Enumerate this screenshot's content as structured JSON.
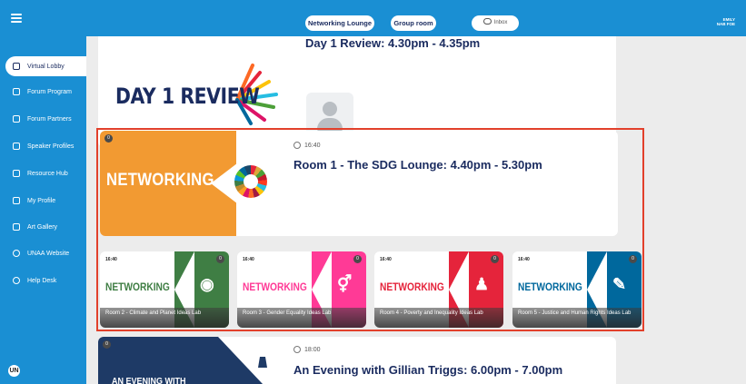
{
  "topbar": {
    "networking_lounge": "Networking Lounge",
    "group_room": "Group room",
    "inbox": "Inbox",
    "brand_line1": "EMILY",
    "brand_line2": "NAB FOE"
  },
  "sidebar": {
    "items": [
      {
        "label": "Virtual Lobby",
        "icon": "home-icon",
        "active": true
      },
      {
        "label": "Forum Program",
        "icon": "edit-icon"
      },
      {
        "label": "Forum Partners",
        "icon": "play-icon"
      },
      {
        "label": "Speaker Profiles",
        "icon": "user-icon"
      },
      {
        "label": "Resource Hub",
        "icon": "folder-icon"
      },
      {
        "label": "My Profile",
        "icon": "id-card-icon"
      },
      {
        "label": "Art Gallery",
        "icon": "gallery-icon"
      },
      {
        "label": "UNAA Website",
        "icon": "info-icon"
      },
      {
        "label": "Help Desk",
        "icon": "help-icon"
      }
    ],
    "logo_text": "UN"
  },
  "sessions": [
    {
      "title": "Day 1 Review: 4.30pm - 4.35pm",
      "banner": "DAY 1 REVIEW"
    },
    {
      "badge": "0",
      "time": "16:40",
      "title": "Room 1 - The SDG Lounge: 4.40pm - 5.30pm",
      "banner": "NETWORKING"
    },
    {
      "badge": "0",
      "time": "18:00",
      "title": "An Evening with Gillian Triggs: 6.00pm - 7.00pm",
      "banner": "AN EVENING WITH"
    }
  ],
  "rooms": [
    {
      "time": "16:40",
      "banner": "NETWORKING",
      "label": "Room 2 - Climate and Planet Ideas Lab",
      "badge": "0",
      "color": "#3f7e44",
      "glyph": "◉"
    },
    {
      "time": "16:40",
      "banner": "NETWORKING",
      "label": "Room 3 - Gender Equality Ideas Lab",
      "badge": "0",
      "color": "#ff3a96",
      "glyph": "⚥"
    },
    {
      "time": "16:40",
      "banner": "NETWORKING",
      "label": "Room 4 - Poverty and Inequality Ideas Lab",
      "badge": "0",
      "color": "#e5243b",
      "glyph": "♟"
    },
    {
      "time": "16:40",
      "banner": "NETWORKING",
      "label": "Room 5 - Justice and Human Rights Ideas Lab",
      "badge": "0",
      "color": "#00689d",
      "glyph": "✎"
    }
  ],
  "colors": {
    "primary": "#1a8fd3",
    "navy": "#1a2b5f",
    "networking_orange": "#f29a32",
    "highlight": "#e2402b"
  }
}
